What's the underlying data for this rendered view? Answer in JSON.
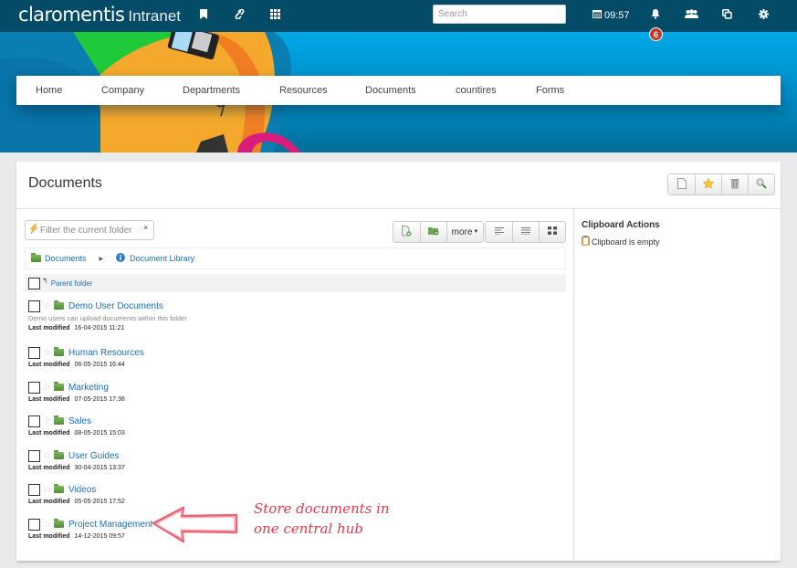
{
  "topbar": {
    "brand": "claromentis",
    "brand_sub": "Intranet",
    "search_placeholder": "Search",
    "time": "09:57",
    "notification_count": "6",
    "icons": [
      "bookmark-icon",
      "link-icon",
      "apps-grid-icon",
      "calendar-icon",
      "bell-icon",
      "people-icon",
      "copy-icon",
      "gear-icon"
    ]
  },
  "nav": {
    "items": [
      "Home",
      "Company",
      "Departments",
      "Resources",
      "Documents",
      "countires",
      "Forms"
    ]
  },
  "page": {
    "title": "Documents",
    "header_actions": [
      "new-document",
      "favourites",
      "recycle-bin",
      "search"
    ]
  },
  "toolbar": {
    "filter_placeholder": "Filter the current folder",
    "filter_clear": "×",
    "more_label": "more",
    "actions": [
      "add-file",
      "add-folder",
      "more",
      "view-list",
      "view-details",
      "view-grid"
    ]
  },
  "breadcrumb": {
    "root": "Documents",
    "current": "Document Library"
  },
  "list": {
    "parent_label": "Parent folder",
    "modified_label": "Last modified",
    "items": [
      {
        "name": "Demo User Documents",
        "description": "Demo users can upload documents within this folder",
        "modified": "16-04-2015 11:21"
      },
      {
        "name": "Human Resources",
        "description": "",
        "modified": "06-05-2015 16:44"
      },
      {
        "name": "Marketing",
        "description": "",
        "modified": "07-05-2015 17:38"
      },
      {
        "name": "Sales",
        "description": "",
        "modified": "08-05-2015 15:03"
      },
      {
        "name": "User Guides",
        "description": "",
        "modified": "30-04-2015 13:37"
      },
      {
        "name": "Videos",
        "description": "",
        "modified": "05-05-2015 17:52"
      },
      {
        "name": "Project Management",
        "description": "",
        "modified": "14-12-2015 09:57"
      }
    ]
  },
  "clipboard": {
    "title": "Clipboard Actions",
    "status": "Clipboard is empty"
  },
  "annotation": {
    "line1": "Store documents in",
    "line2": "one central hub",
    "color": "#e23b4e"
  },
  "colors": {
    "topbar": "#034b67",
    "link": "#1a6fb5",
    "badge": "#c0392b",
    "banner": "#00a8e6"
  }
}
